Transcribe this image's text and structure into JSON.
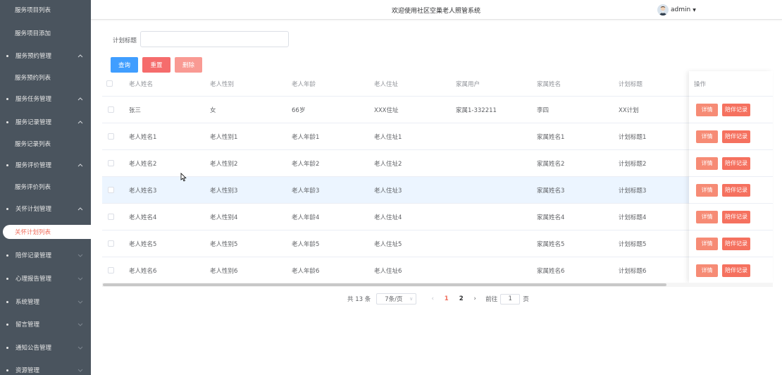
{
  "sidebar": {
    "items": [
      {
        "label": "服务项目列表",
        "type": "child"
      },
      {
        "label": "服务项目添加",
        "type": "child"
      },
      {
        "label": "服务预约管理",
        "type": "group",
        "expanded": true
      },
      {
        "label": "服务预约列表",
        "type": "child"
      },
      {
        "label": "服务任务管理",
        "type": "group",
        "expanded": true
      },
      {
        "label": "服务记录管理",
        "type": "group",
        "expanded": true
      },
      {
        "label": "服务记录列表",
        "type": "child"
      },
      {
        "label": "服务评价管理",
        "type": "group",
        "expanded": true
      },
      {
        "label": "服务评价列表",
        "type": "child"
      },
      {
        "label": "关怀计划管理",
        "type": "group",
        "expanded": true
      },
      {
        "label": "关怀计划列表",
        "type": "child",
        "active": true
      },
      {
        "label": "陪伴记录管理",
        "type": "group",
        "expanded": false
      },
      {
        "label": "心理报告管理",
        "type": "group",
        "expanded": false
      },
      {
        "label": "系统管理",
        "type": "group",
        "expanded": false
      },
      {
        "label": "留言管理",
        "type": "group",
        "expanded": false
      },
      {
        "label": "通知公告管理",
        "type": "group",
        "expanded": false
      },
      {
        "label": "资源管理",
        "type": "group",
        "expanded": false
      }
    ]
  },
  "header": {
    "title": "欢迎使用社区空巢老人照管系统",
    "user": "admin"
  },
  "search": {
    "label": "计划标题",
    "value": "",
    "query_label": "查询",
    "reset_label": "重置",
    "delete_label": "删除"
  },
  "table": {
    "columns": [
      "老人姓名",
      "老人性别",
      "老人年龄",
      "老人住址",
      "家属用户",
      "家属姓名",
      "计划标题",
      "操作"
    ],
    "rows": [
      [
        "张三",
        "女",
        "66岁",
        "XXX住址",
        "家属1-332211",
        "李四",
        "XX计划"
      ],
      [
        "老人姓名1",
        "老人性别1",
        "老人年龄1",
        "老人住址1",
        "",
        "家属姓名1",
        "计划标题1"
      ],
      [
        "老人姓名2",
        "老人性别2",
        "老人年龄2",
        "老人住址2",
        "",
        "家属姓名2",
        "计划标题2"
      ],
      [
        "老人姓名3",
        "老人性别3",
        "老人年龄3",
        "老人住址3",
        "",
        "家属姓名3",
        "计划标题3"
      ],
      [
        "老人姓名4",
        "老人性别4",
        "老人年龄4",
        "老人住址4",
        "",
        "家属姓名4",
        "计划标题4"
      ],
      [
        "老人姓名5",
        "老人性别5",
        "老人年龄5",
        "老人住址5",
        "",
        "家属姓名5",
        "计划标题5"
      ],
      [
        "老人姓名6",
        "老人性别6",
        "老人年龄6",
        "老人住址6",
        "",
        "家属姓名6",
        "计划标题6"
      ]
    ],
    "hover_row": 3,
    "detail_label": "详情",
    "record_label": "陪伴记录"
  },
  "pagination": {
    "total_text": "共 13 条",
    "page_size": "7条/页",
    "pages": [
      "1",
      "2"
    ],
    "current_page": "1",
    "goto_label": "前往",
    "goto_value": "1",
    "page_suffix": "页"
  },
  "colors": {
    "sidebar_bg": "#4a545e",
    "accent": "#f06c5b",
    "primary": "#409eff",
    "danger": "#f56c6c"
  }
}
